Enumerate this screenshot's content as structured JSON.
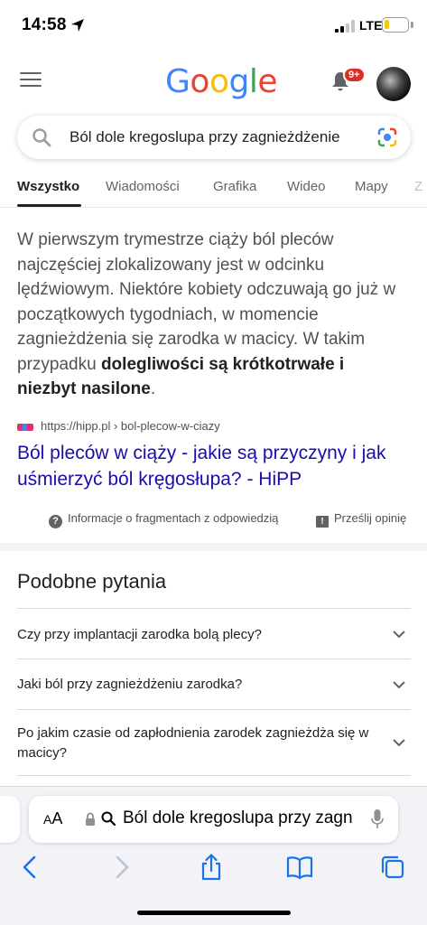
{
  "status_bar": {
    "time": "14:58",
    "network": "LTE",
    "battery_level": 0.2
  },
  "header": {
    "logo_letters": [
      {
        "ch": "G",
        "color": "#4285F4"
      },
      {
        "ch": "o",
        "color": "#EA4335"
      },
      {
        "ch": "o",
        "color": "#FBBC05"
      },
      {
        "ch": "g",
        "color": "#4285F4"
      },
      {
        "ch": "l",
        "color": "#34A853"
      },
      {
        "ch": "e",
        "color": "#EA4335"
      }
    ],
    "notification_count": "9+"
  },
  "search": {
    "query": "Ból dole kregoslupa przy zagnieżdżenie"
  },
  "tabs": [
    {
      "label": "Wszystko",
      "active": true
    },
    {
      "label": "Wiadomości",
      "active": false
    },
    {
      "label": "Grafika",
      "active": false
    },
    {
      "label": "Wideo",
      "active": false
    },
    {
      "label": "Mapy",
      "active": false
    },
    {
      "label": "Z",
      "active": false
    }
  ],
  "snippet": {
    "text_plain": "W pierwszym trymestrze ciąży ból pleców najczęściej zlokalizowany jest w odcinku lędźwiowym. Niektóre kobiety odczuwają go już w początkowych tygodniach, w momencie zagnieżdżenia się zarodka w macicy. W takim przypadku ",
    "text_bold": "dolegliwości są krótkotrwałe i niezbyt nasilone",
    "text_end": ".",
    "source_url": "https://hipp.pl › bol-plecow-w-ciazy",
    "result_title": "Ból pleców w ciąży - jakie są przyczyny i jak uśmierzyć ból kręgosłupa? - HiPP",
    "about_label": "Informacje o fragmentach z odpowiedzią",
    "feedback_label": "Prześlij opinię"
  },
  "related": {
    "title": "Podobne pytania",
    "questions": [
      "Czy przy implantacji zarodka bolą plecy?",
      "Jaki ból przy zagnieżdżeniu zarodka?",
      "Po jakim czasie od zapłodnienia zarodek zagnieżdża się w macicy?"
    ]
  },
  "safari": {
    "aa_label": "AA",
    "address_text": "Ból dole kregoslupa przy zagnieżdżenie"
  },
  "colors": {
    "link": "#1a0dab",
    "text_secondary": "#4d5156",
    "badge": "#d93025"
  }
}
